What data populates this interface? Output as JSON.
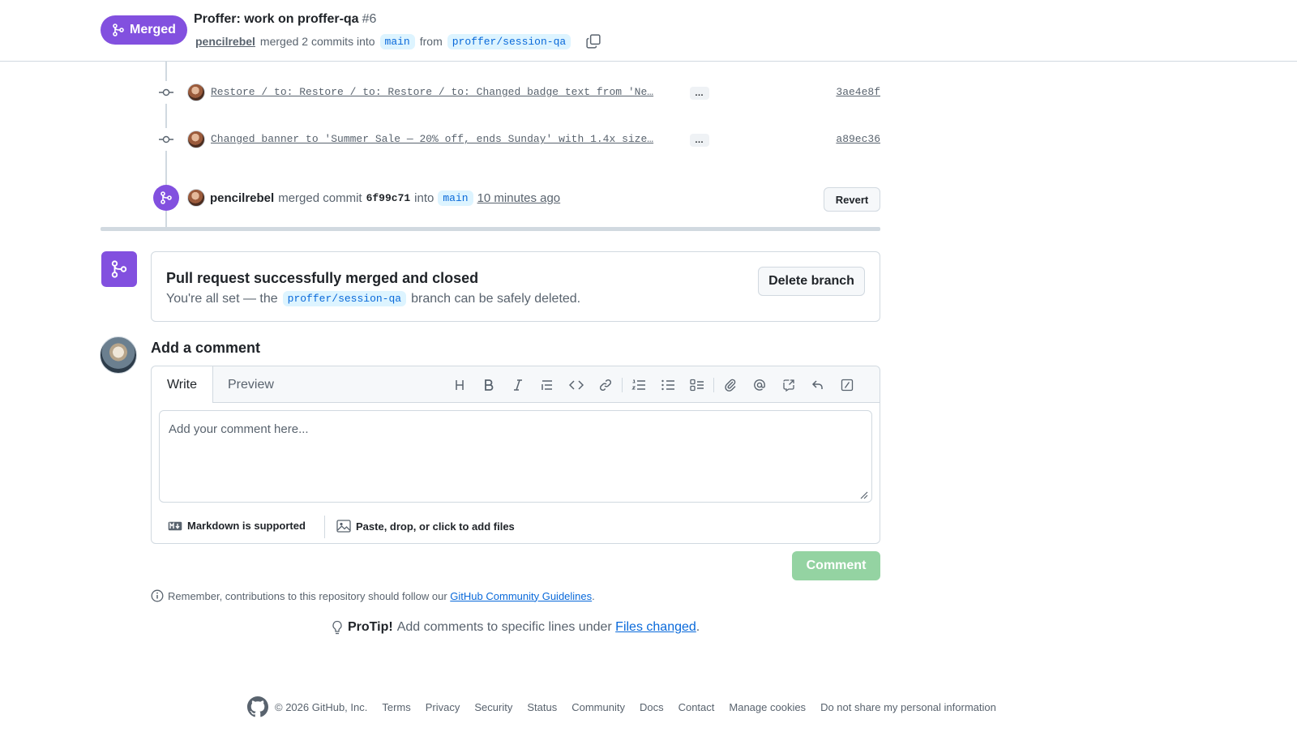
{
  "header": {
    "status_badge": "Merged",
    "title": "Proffer: work on proffer-qa",
    "number": "#6",
    "author": "pencilrebel",
    "merged_text": "merged 2 commits into",
    "base_branch": "main",
    "from_text": "from",
    "head_branch": "proffer/session-qa"
  },
  "commits": [
    {
      "message": "Restore / to: Restore / to: Restore / to: Changed badge text from 'Ne…",
      "more": "…",
      "sha": "3ae4e8f"
    },
    {
      "message": "Changed banner to 'Summer Sale — 20% off, ends Sunday' with 1.4x size…",
      "more": "…",
      "sha": "a89ec36"
    }
  ],
  "merge_event": {
    "author": "pencilrebel",
    "text": "merged commit",
    "sha": "6f99c71",
    "into": "into",
    "branch": "main",
    "time": "10 minutes ago",
    "revert_label": "Revert"
  },
  "merge_box": {
    "title": "Pull request successfully merged and closed",
    "sub_before": "You're all set — the",
    "branch": "proffer/session-qa",
    "sub_after": "branch can be safely deleted.",
    "delete_label": "Delete branch"
  },
  "comment": {
    "heading": "Add a comment",
    "tab_write": "Write",
    "tab_preview": "Preview",
    "placeholder": "Add your comment here...",
    "markdown_note": "Markdown is supported",
    "attach_note": "Paste, drop, or click to add files",
    "submit_label": "Comment"
  },
  "guidelines": {
    "text": "Remember, contributions to this repository should follow our",
    "link": "GitHub Community Guidelines",
    "end": "."
  },
  "protip": {
    "label": "ProTip!",
    "text": "Add comments to specific lines under",
    "link": "Files changed",
    "end": "."
  },
  "footer": {
    "copyright": "© 2026 GitHub, Inc.",
    "links": [
      "Terms",
      "Privacy",
      "Security",
      "Status",
      "Community",
      "Docs",
      "Contact",
      "Manage cookies",
      "Do not share my personal information"
    ]
  },
  "colors": {
    "merged_purple": "#8250df",
    "link_blue": "#0969da",
    "branch_bg": "#ddf4ff",
    "comment_btn_disabled": "#94d3a2"
  }
}
